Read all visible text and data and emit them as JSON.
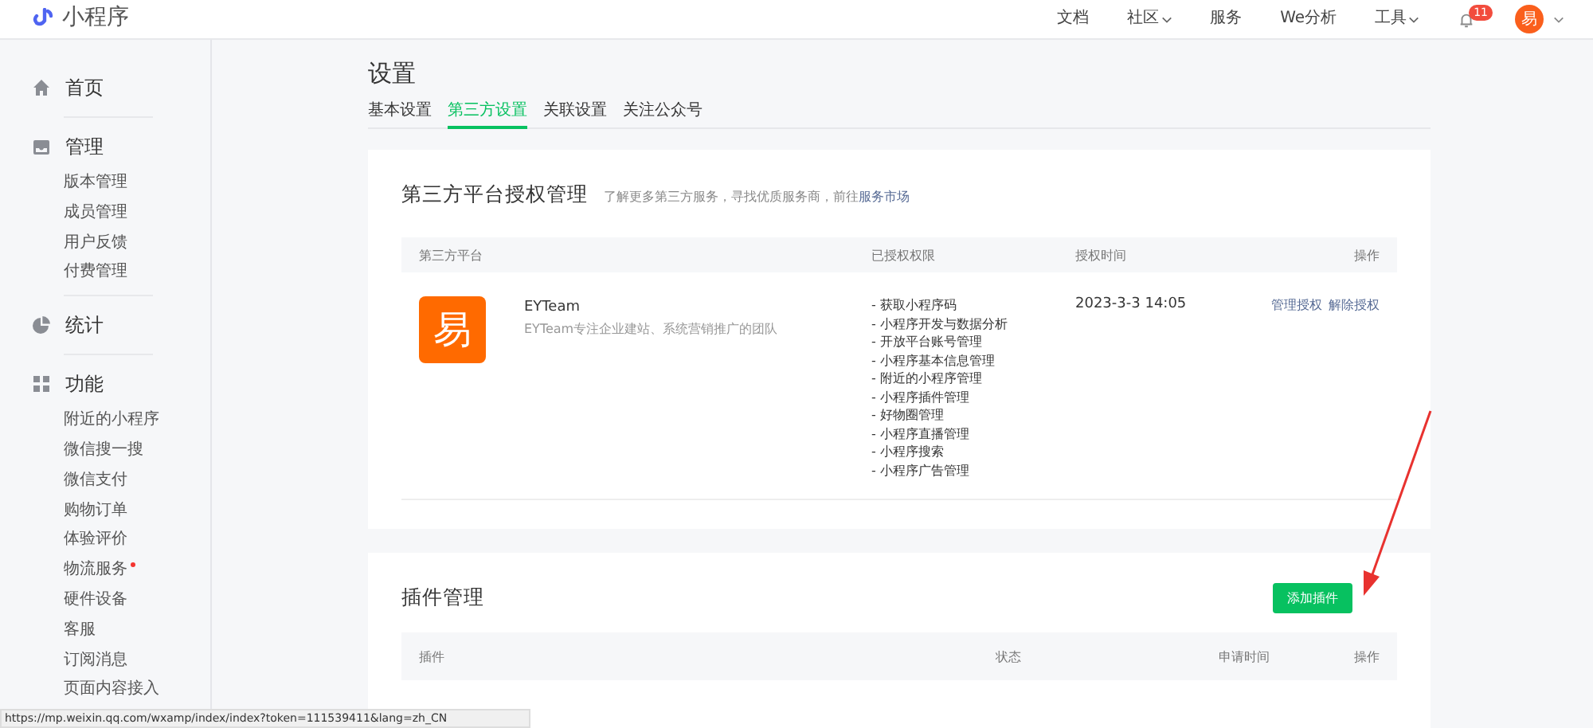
{
  "header": {
    "logo_text": "小程序",
    "nav": [
      {
        "label": "文档",
        "dropdown": false
      },
      {
        "label": "社区",
        "dropdown": true
      },
      {
        "label": "服务",
        "dropdown": false
      },
      {
        "label": "We分析",
        "dropdown": false
      },
      {
        "label": "工具",
        "dropdown": true
      }
    ],
    "notification_badge": "11",
    "avatar_text": "易"
  },
  "sidebar": {
    "sections": [
      {
        "label": "首页"
      },
      {
        "label": "管理",
        "items": [
          {
            "label": "版本管理",
            "dot": false
          },
          {
            "label": "成员管理",
            "dot": false
          },
          {
            "label": "用户反馈",
            "dot": false
          },
          {
            "label": "付费管理",
            "dot": false
          }
        ]
      },
      {
        "label": "统计"
      },
      {
        "label": "功能",
        "items": [
          {
            "label": "附近的小程序",
            "dot": false
          },
          {
            "label": "微信搜一搜",
            "dot": false
          },
          {
            "label": "微信支付",
            "dot": false
          },
          {
            "label": "购物订单",
            "dot": false
          },
          {
            "label": "体验评价",
            "dot": false
          },
          {
            "label": "物流服务",
            "dot": true
          },
          {
            "label": "硬件设备",
            "dot": false
          },
          {
            "label": "客服",
            "dot": false
          },
          {
            "label": "订阅消息",
            "dot": false
          },
          {
            "label": "页面内容接入",
            "dot": false
          }
        ]
      }
    ]
  },
  "page": {
    "title": "设置",
    "tabs": [
      {
        "label": "基本设置",
        "selected": false
      },
      {
        "label": "第三方设置",
        "selected": true
      },
      {
        "label": "关联设置",
        "selected": false
      },
      {
        "label": "关注公众号",
        "selected": false
      }
    ]
  },
  "third_party": {
    "title": "第三方平台授权管理",
    "hint": "了解更多第三方服务，寻找优质服务商，前往",
    "hint_link": "服务市场",
    "columns": [
      "第三方平台",
      "已授权权限",
      "授权时间",
      "操作"
    ],
    "rows": [
      {
        "logo_text": "易",
        "name": "EYTeam",
        "description": "EYTeam专注企业建站、系统营销推广的团队",
        "permissions": [
          "- 获取小程序码",
          "- 小程序开发与数据分析",
          "- 开放平台账号管理",
          "- 小程序基本信息管理",
          "- 附近的小程序管理",
          "- 小程序插件管理",
          "- 好物圈管理",
          "- 小程序直播管理",
          "- 小程序搜索",
          "- 小程序广告管理"
        ],
        "time": "2023-3-3 14:05",
        "actions": [
          "管理授权",
          "解除授权"
        ]
      }
    ]
  },
  "plugins": {
    "title": "插件管理",
    "button": "添加插件",
    "columns": [
      "插件",
      "状态",
      "申请时间",
      "操作"
    ]
  },
  "status_bar": "https://mp.weixin.qq.com/wxamp/index/index?token=111539411&lang=zh_CN"
}
